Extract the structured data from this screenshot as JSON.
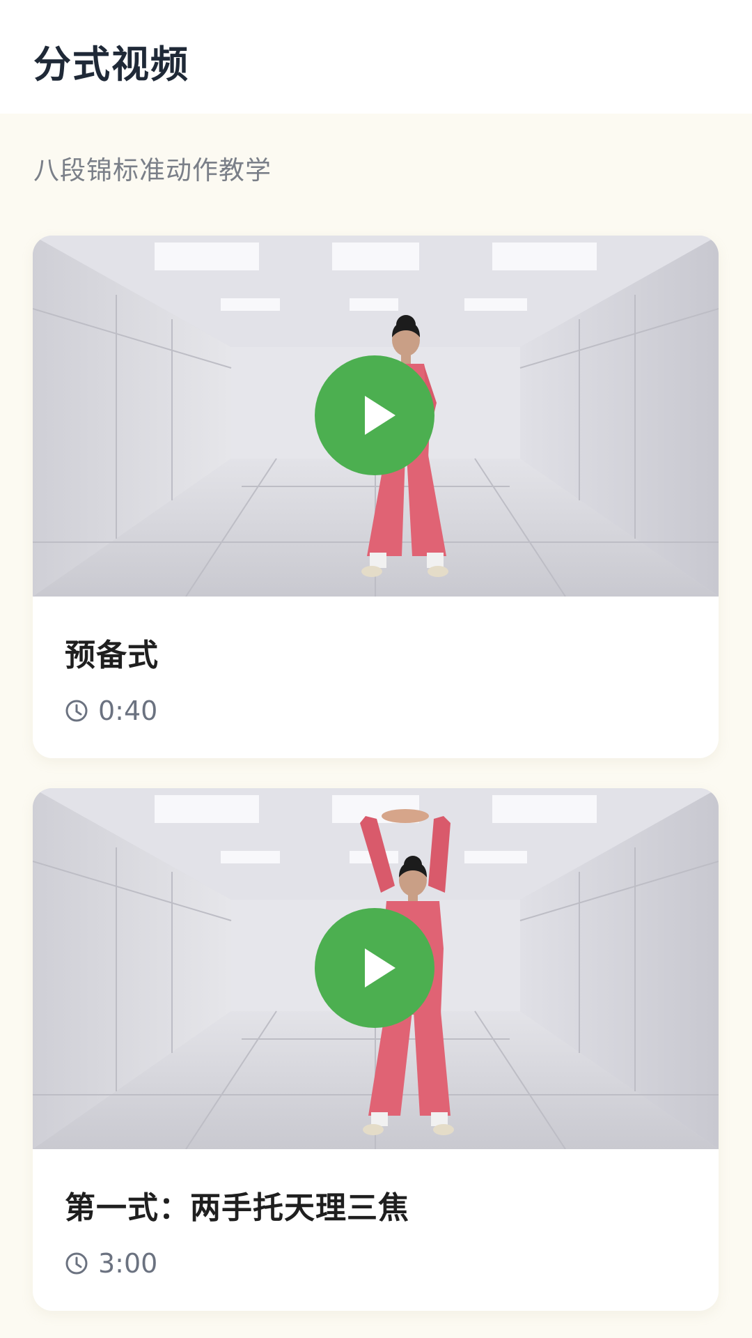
{
  "header": {
    "title": "分式视频"
  },
  "subtitle": "八段锦标准动作教学",
  "videos": [
    {
      "title": "预备式",
      "duration": "0:40",
      "pose": "ready"
    },
    {
      "title": "第一式：两手托天理三焦",
      "duration": "3:00",
      "pose": "arms-up"
    }
  ],
  "icons": {
    "play": "play-icon",
    "clock": "clock-icon"
  },
  "colors": {
    "accent": "#4caf50",
    "background": "#fcfaf2",
    "outfit": "#e06374"
  }
}
